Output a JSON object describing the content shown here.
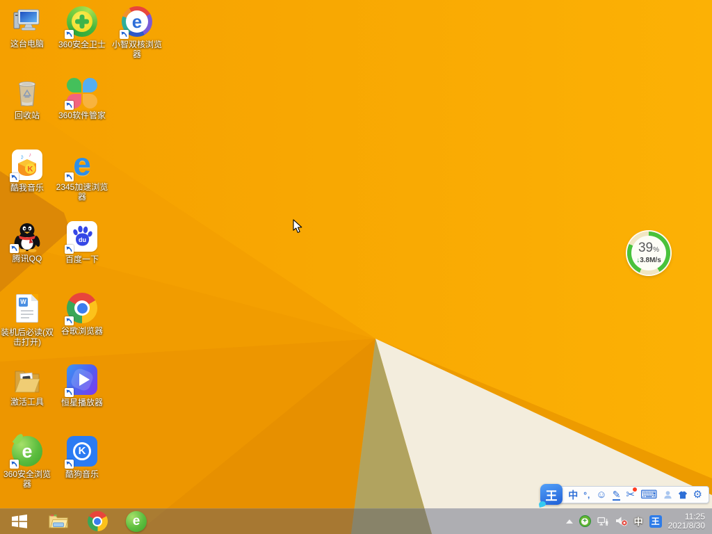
{
  "desktop": {
    "icons": [
      {
        "name": "this-pc",
        "label": "这台电脑"
      },
      {
        "name": "360-safe-guard",
        "label": "360安全卫士"
      },
      {
        "name": "xiaozhi-browser",
        "label": "小智双核浏览器",
        "glyph": "e"
      },
      {
        "name": "recycle-bin",
        "label": "回收站"
      },
      {
        "name": "360-software-manager",
        "label": "360软件管家"
      },
      {
        "name": "kuwo-music",
        "label": "酷我音乐",
        "glyph": "K",
        "note1": "♪",
        "note2": "♪"
      },
      {
        "name": "2345-browser",
        "label": "2345加速浏览器",
        "glyph": "e"
      },
      {
        "name": "tencent-qq",
        "label": "腾讯QQ"
      },
      {
        "name": "baidu",
        "label": "百度一下",
        "glyph": "du"
      },
      {
        "name": "readme-doc",
        "label": "装机后必读(双击打开)",
        "glyph": "W"
      },
      {
        "name": "chrome",
        "label": "谷歌浏览器"
      },
      {
        "name": "activation-tool",
        "label": "激活工具"
      },
      {
        "name": "hengxing-player",
        "label": "恒星播放器"
      },
      {
        "name": "360-browser",
        "label": "360安全浏览器",
        "glyph": "e"
      },
      {
        "name": "kugou-music",
        "label": "酷狗音乐",
        "glyph": "K"
      }
    ]
  },
  "download_widget": {
    "percent": "39",
    "percent_sign": "%",
    "arrow": "↓",
    "speed": "3.8M/s"
  },
  "ime": {
    "logo": "王",
    "mode": "中",
    "punct": "°,",
    "emoji": "☺",
    "pencil": "✎",
    "scissors": "✂",
    "keyboard": "⌨",
    "gear": "⚙"
  },
  "tray": {
    "mode": "中",
    "logo": "王",
    "time": "11:25",
    "date": "2021/8/30"
  },
  "colors": {
    "wallpaper_amber": "#F8A701",
    "wallpaper_dark_fold": "#DC8806",
    "wallpaper_olive": "#B1A35F",
    "wallpaper_cream": "#F3EDDD",
    "taskbar_tint": "rgba(78,88,118,0.42)",
    "progress_green": "#49C23C",
    "ime_blue": "#2E6FD6"
  }
}
